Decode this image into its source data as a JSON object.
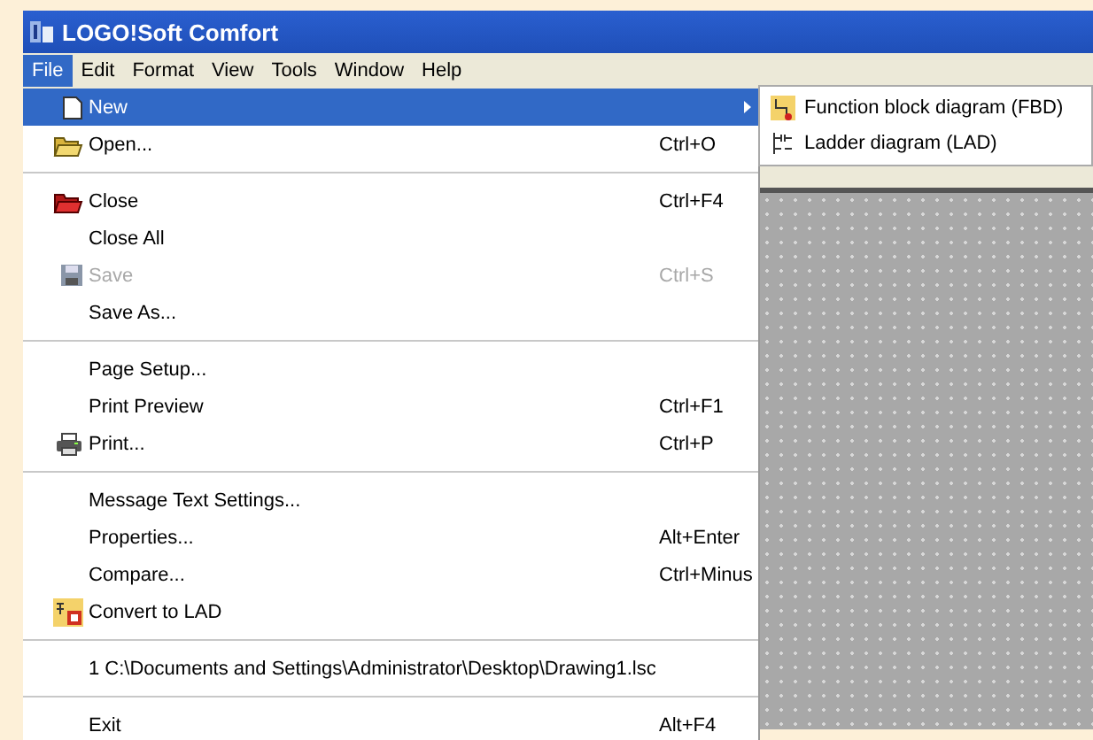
{
  "window": {
    "title": "LOGO!Soft Comfort"
  },
  "menubar": [
    {
      "label": "File",
      "selected": true
    },
    {
      "label": "Edit",
      "selected": false
    },
    {
      "label": "Format",
      "selected": false
    },
    {
      "label": "View",
      "selected": false
    },
    {
      "label": "Tools",
      "selected": false
    },
    {
      "label": "Window",
      "selected": false
    },
    {
      "label": "Help",
      "selected": false
    }
  ],
  "file_menu": [
    {
      "kind": "item",
      "label": "New",
      "selected": true,
      "disabled": false,
      "submenu": true
    },
    {
      "kind": "item",
      "label": "Open...",
      "shortcut": "Ctrl+O",
      "selected": false,
      "disabled": false
    },
    {
      "kind": "separator"
    },
    {
      "kind": "item",
      "label": "Close",
      "shortcut": "Ctrl+F4",
      "selected": false,
      "disabled": false
    },
    {
      "kind": "item",
      "label": "Close All",
      "selected": false,
      "disabled": false
    },
    {
      "kind": "item",
      "label": "Save",
      "shortcut": "Ctrl+S",
      "selected": false,
      "disabled": true
    },
    {
      "kind": "item",
      "label": "Save As...",
      "selected": false,
      "disabled": false
    },
    {
      "kind": "separator"
    },
    {
      "kind": "item",
      "label": "Page Setup...",
      "selected": false,
      "disabled": false
    },
    {
      "kind": "item",
      "label": "Print Preview",
      "shortcut": "Ctrl+F1",
      "selected": false,
      "disabled": false
    },
    {
      "kind": "item",
      "label": "Print...",
      "shortcut": "Ctrl+P",
      "selected": false,
      "disabled": false
    },
    {
      "kind": "separator"
    },
    {
      "kind": "item",
      "label": "Message Text Settings...",
      "selected": false,
      "disabled": false
    },
    {
      "kind": "item",
      "label": "Properties...",
      "shortcut": "Alt+Enter",
      "selected": false,
      "disabled": false
    },
    {
      "kind": "item",
      "label": "Compare...",
      "shortcut": "Ctrl+Minus",
      "selected": false,
      "disabled": false
    },
    {
      "kind": "item",
      "label": "Convert to LAD",
      "selected": false,
      "disabled": false
    },
    {
      "kind": "separator"
    },
    {
      "kind": "item",
      "label": "1 C:\\Documents and Settings\\Administrator\\Desktop\\Drawing1.lsc",
      "selected": false,
      "disabled": false
    },
    {
      "kind": "separator"
    },
    {
      "kind": "item",
      "label": "Exit",
      "shortcut": "Alt+F4",
      "selected": false,
      "disabled": false
    }
  ],
  "new_submenu": [
    {
      "label": "Function block diagram (FBD)"
    },
    {
      "label": "Ladder diagram (LAD)"
    }
  ]
}
